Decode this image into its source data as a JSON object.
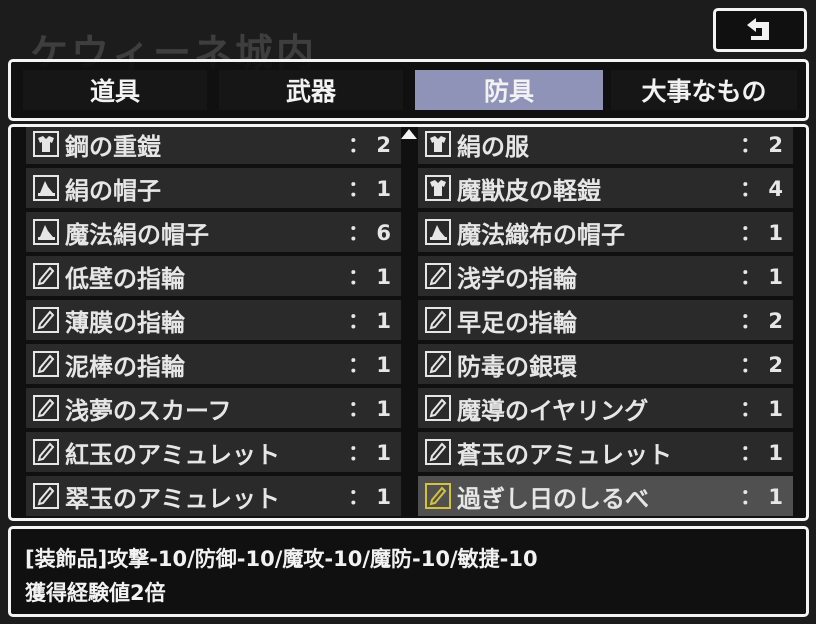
{
  "background_title": "ケウィーネ城内",
  "back_button": {
    "icon": "return-arrow-icon"
  },
  "tabs": [
    {
      "label": "道具",
      "active": false
    },
    {
      "label": "武器",
      "active": false
    },
    {
      "label": "防具",
      "active": true
    },
    {
      "label": "大事なもの",
      "active": false
    }
  ],
  "items": [
    {
      "name": "鋼の重鎧",
      "count": "： 2",
      "icon": "armor-icon",
      "selected": false
    },
    {
      "name": "絹の服",
      "count": "： 2",
      "icon": "armor-icon",
      "selected": false
    },
    {
      "name": "絹の帽子",
      "count": "： 1",
      "icon": "hat-icon",
      "selected": false
    },
    {
      "name": "魔獣皮の軽鎧",
      "count": "： 4",
      "icon": "light-armor-icon",
      "selected": false
    },
    {
      "name": "魔法絹の帽子",
      "count": "： 6",
      "icon": "hat-icon",
      "selected": false
    },
    {
      "name": "魔法織布の帽子",
      "count": "： 1",
      "icon": "hat-icon",
      "selected": false
    },
    {
      "name": "低壁の指輪",
      "count": "： 1",
      "icon": "accessory-icon",
      "selected": false
    },
    {
      "name": "浅学の指輪",
      "count": "： 1",
      "icon": "accessory-icon",
      "selected": false
    },
    {
      "name": "薄膜の指輪",
      "count": "： 1",
      "icon": "accessory-icon",
      "selected": false
    },
    {
      "name": "早足の指輪",
      "count": "： 2",
      "icon": "accessory-icon",
      "selected": false
    },
    {
      "name": "泥棒の指輪",
      "count": "： 1",
      "icon": "accessory-icon",
      "selected": false
    },
    {
      "name": "防毒の銀環",
      "count": "： 2",
      "icon": "accessory-icon",
      "selected": false
    },
    {
      "name": "浅夢のスカーフ",
      "count": "： 1",
      "icon": "accessory-icon",
      "selected": false
    },
    {
      "name": "魔導のイヤリング",
      "count": "： 1",
      "icon": "accessory-icon",
      "selected": false
    },
    {
      "name": "紅玉のアミュレット",
      "count": "： 1",
      "icon": "accessory-icon",
      "selected": false
    },
    {
      "name": "蒼玉のアミュレット",
      "count": "： 1",
      "icon": "accessory-icon",
      "selected": false
    },
    {
      "name": "翠玉のアミュレット",
      "count": "： 1",
      "icon": "accessory-icon",
      "selected": false
    },
    {
      "name": "過ぎし日のしるべ",
      "count": "： 1",
      "icon": "accessory-icon",
      "selected": true
    }
  ],
  "description": {
    "line1": "[装飾品]攻撃-10/防御-10/魔攻-10/魔防-10/敏捷-10",
    "line2": "獲得経験値2倍"
  },
  "colors": {
    "tab_active": "#8f93b8",
    "row_bg": "#2a2a2a",
    "row_selected": "#505050",
    "selected_icon": "#d4c23a",
    "border": "#f4f4f4"
  }
}
